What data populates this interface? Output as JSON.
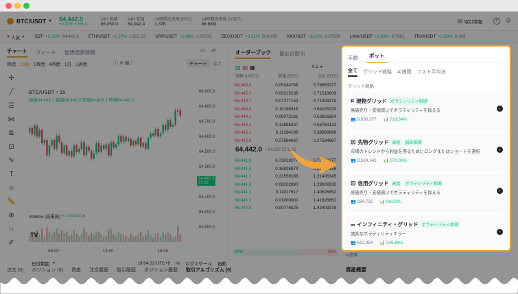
{
  "header": {
    "pair": "BTC/USDT",
    "price": "64,442.0",
    "price_sub": "+0.32% +205.8",
    "stats": [
      {
        "label": "24H 高値",
        "value": "65,050.0"
      },
      {
        "label": "24H 安値",
        "value": "64,042.4"
      },
      {
        "label": "24時間出来高 (BTC)",
        "value": "1.37K"
      },
      {
        "label": "24時間出来高 (USDT)",
        "value": "88.98M"
      }
    ],
    "trade_info": "取引情報"
  },
  "ticker": {
    "popular": "人気",
    "items": [
      {
        "sym": "SDT",
        "chg": "+0.32%",
        "px": "64,442.0",
        "up": true
      },
      {
        "sym": "ETH/USDT",
        "chg": "+1.27%",
        "px": "1,923.22",
        "up": true
      },
      {
        "sym": "XRP/USDT",
        "chg": "+1.08%",
        "px": "1.00736",
        "up": true
      },
      {
        "sym": "ZEC/USDT",
        "chg": "+0.51%",
        "px": "508.650",
        "up": true
      },
      {
        "sym": "KK/USDT",
        "chg": "+8.23%",
        "px": "0.07156",
        "up": true
      },
      {
        "sym": "LINK/USDT",
        "chg": "+3.88%",
        "px": "9.7991",
        "up": true
      },
      {
        "sym": "TRX/USDT",
        "chg": "+0.39%",
        "px": "0.309",
        "up": true
      }
    ]
  },
  "chart_panel": {
    "tabs": [
      "チャート",
      "フィード",
      "仮想通貨情報"
    ],
    "intervals": [
      "時間",
      "15分",
      "1時間",
      "4時間",
      "1日",
      "1週間"
    ],
    "chart_btn": "チャート",
    "depth_btn": "深さ",
    "symbol_line": "BTC/USDT・15",
    "ohlc": "始値64,403.2 高値64,442.0 安値64,403.2 終値64,442.0",
    "price_axis": [
      "64,900.0",
      "64,800.0",
      "64,700.0",
      "64,600.0",
      "64,500.0",
      "64,300.0",
      "64,200.0",
      "64,100.0",
      "64,000.0",
      "63,900.0"
    ],
    "current_price_tag": "64,442.0",
    "current_price_time": "10:32",
    "volume_label": "Volume (出来高)",
    "volume_value": "5.74374416",
    "times": [
      "06:00",
      "12:00",
      "18:00"
    ],
    "date_range": "日付範囲",
    "clock": "18:04:22 UTC+9",
    "pct": "%",
    "log_scale": "ログスケール",
    "auto": "自動"
  },
  "orderbook": {
    "tabs": [
      "オーダーブック",
      "最近の取引"
    ],
    "cols": [
      "価格 (USDT)",
      "数量 (BTC)",
      "合計 (BTC)"
    ],
    "step": "0.1",
    "asks": [
      [
        "64,445.6",
        "0.05344768",
        "0.76863377"
      ],
      [
        "64,445.2",
        "0.00215236",
        "0.71518609"
      ],
      [
        "64,444.7",
        "0.07277153",
        "0.71303373"
      ],
      [
        "64,444.6",
        "0.10199916",
        "0.64026220"
      ],
      [
        "64,444.1",
        "0.00072181",
        "0.53826304"
      ],
      [
        "64,443.3",
        "0.14886237",
        "0.53754123"
      ],
      [
        "64,442.1",
        "0.11284199",
        "0.38868886"
      ],
      [
        "64,442.0",
        "0.27584687",
        "0.27584687"
      ]
    ],
    "mid": "64,442.0",
    "mid_sub": "≈ 64,337.55 USD",
    "bids": [
      [
        "64,441.9",
        "0.73018277",
        "0.73018277"
      ],
      [
        "64,441.8",
        "0.16828879",
        "0.89847156"
      ],
      [
        "64,441.7",
        "0.31559188",
        "1.21406345"
      ],
      [
        "64,441.6",
        "0.08202890",
        "1.29609235"
      ],
      [
        "64,441.3",
        "0.11017617",
        "1.40626852"
      ],
      [
        "64,441.2",
        "0.01000000",
        "1.41626852"
      ],
      [
        "64,440.6",
        "0.00776526",
        "1.42403378"
      ]
    ],
    "buy_pct": "64%",
    "sell_pct": "36%"
  },
  "bottom_tabs": [
    "注文 (0)",
    "ポジション (0)",
    "資産",
    "注文履歴",
    "取引履歴",
    "ポジション履歴",
    "取引アルゴリズム (0)"
  ],
  "right_bottom": {
    "ai": "AI搭載",
    "asset": "資産概要"
  },
  "modal": {
    "top_tabs": [
      "手動",
      "ボット"
    ],
    "filters": [
      "全て",
      "グリッド戦略",
      "AI搭載",
      "コスト平均法"
    ],
    "section": "グリッド戦略",
    "cards": [
      {
        "title": "現物グリッド",
        "tags": [
          "ボラティリティ相場"
        ],
        "desc": "高値売り・安値買いでボラティリティを抑える",
        "users": "9,930,377",
        "roi": "718.54%"
      },
      {
        "title": "先物グリッド",
        "tags": [
          "高度",
          "弱気相場"
        ],
        "desc": "市場のトレンドから利益を得るためにロングまたはショートを選択",
        "users": "3,624,145",
        "roi": "576.96%"
      },
      {
        "title": "信用グリッド",
        "tags": [
          "高度",
          "ボラティリティ相場"
        ],
        "desc": "高値売り・安値買いでボラティリティを抑える",
        "users": "284,726",
        "roi": "88.83%"
      },
      {
        "title": "インフィニティ・グリッド",
        "tags": [
          "ボラティリティ相場"
        ],
        "desc": "強気なボラティリティキラー",
        "users": "612,954",
        "roi": "245.69%"
      }
    ]
  },
  "colors": {
    "up": "#0ecb81",
    "down": "#f6465d",
    "accent": "#f0a33a",
    "dark": "#1e2329"
  }
}
